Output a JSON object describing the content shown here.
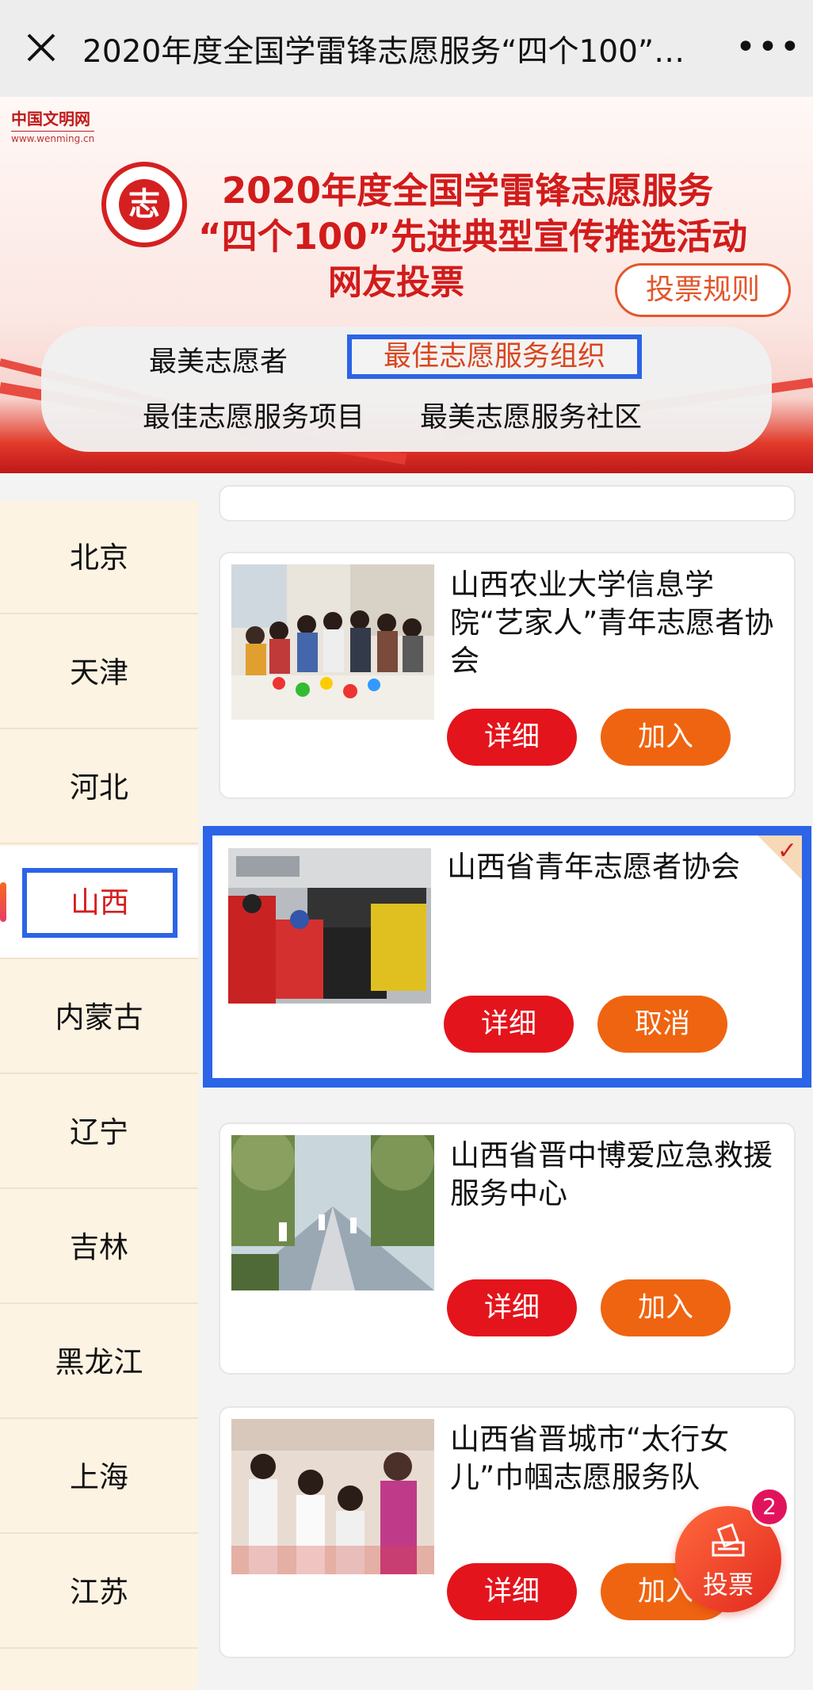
{
  "topbar": {
    "title": "2020年度全国学雷锋志愿服务“四个100”…",
    "more_label": "•••"
  },
  "banner": {
    "site_name": "中国文明网",
    "site_url": "www.wenming.cn",
    "seal_char": "志",
    "title_line1": "2020年度全国学雷锋志愿服务",
    "title_line2": "“四个100”先进典型宣传推选活动",
    "title_line3": "网友投票",
    "rules_label": "投票规则"
  },
  "category_tabs": [
    {
      "label": "最美志愿者"
    },
    {
      "label": "最佳志愿服务组织",
      "selected": true
    },
    {
      "label": "最佳志愿服务项目"
    },
    {
      "label": "最美志愿服务社区"
    }
  ],
  "regions": [
    {
      "label": "北京"
    },
    {
      "label": "天津"
    },
    {
      "label": "河北"
    },
    {
      "label": "山西",
      "active": true
    },
    {
      "label": "内蒙古"
    },
    {
      "label": "辽宁"
    },
    {
      "label": "吉林"
    },
    {
      "label": "黑龙江"
    },
    {
      "label": "上海"
    },
    {
      "label": "江苏"
    }
  ],
  "organizations": [
    {
      "name": "山西农业大学信息学院“艺家人”青年志愿者协会",
      "detail_label": "详细",
      "action_label": "加入",
      "voted": false
    },
    {
      "name": "山西省青年志愿者协会",
      "detail_label": "详细",
      "action_label": "取消",
      "voted": true
    },
    {
      "name": "山西省晋中博爱应急救援服务中心",
      "detail_label": "详细",
      "action_label": "加入",
      "voted": false
    },
    {
      "name": "山西省晋城市“太行女儿”巾帼志愿服务队",
      "detail_label": "详细",
      "action_label": "加入",
      "voted": false
    }
  ],
  "vote_fab": {
    "label": "投票",
    "count": "2"
  },
  "colors": {
    "accent_red": "#e3141c",
    "accent_orange": "#ef6410",
    "highlight_blue": "#2b64e6"
  }
}
